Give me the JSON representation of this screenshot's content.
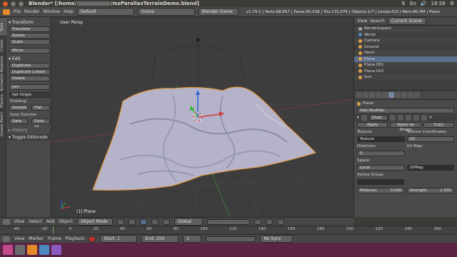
{
  "window": {
    "title": "Blender* [/home/",
    "title_path": "/mzParallaxTerrainDemo.blend]",
    "tray": {
      "net": "⇅",
      "lang": "En",
      "volume": "🔊",
      "time": "16:58",
      "settings": "⚙"
    }
  },
  "menubar": {
    "items": [
      "File",
      "Render",
      "Window",
      "Help"
    ],
    "layout": "Default",
    "scene": "Scene",
    "engine": "Blender Game",
    "stats": "v2.79.1 | Verts:88,657 | Faces:65,536 | Tris:131,076 | Objects:1/7 | Lamps:0/3 | Mem:80.4M | Plane"
  },
  "vtabs": [
    "Tools",
    "Create",
    "Relations",
    "Animation",
    "Physics",
    "Grease Pencil"
  ],
  "tools": {
    "transform_header": "▾ Transform",
    "translate": "Translate",
    "rotate": "Rotate",
    "scale": "Scale",
    "mirror": "Mirror",
    "edit_header": "▾ Edit",
    "duplicate": "Duplicate",
    "duplicate_linked": "Duplicate Linked",
    "delete": "Delete",
    "join": "Join",
    "set_origin": "Set Origin",
    "shading_label": "Shading:",
    "smooth": "Smooth",
    "flat": "Flat",
    "data_transfer_label": "Data Transfer:",
    "data": "Data",
    "data_layout": "Data La",
    "history_header": "▸ History",
    "toggle_editmode": "▾ Toggle Editmode"
  },
  "viewport": {
    "view_label": "User Persp",
    "object_label": "(1) Plane"
  },
  "view_header": {
    "view": "View",
    "select": "Select",
    "add": "Add",
    "object": "Object",
    "mode": "Object Mode",
    "orientation": "Global"
  },
  "timeline": {
    "numbers": [
      "-40",
      "-20",
      "0",
      "20",
      "40",
      "60",
      "80",
      "100",
      "120",
      "140",
      "160",
      "180",
      "200",
      "220",
      "240",
      "260"
    ],
    "view": "View",
    "marker": "Marker",
    "frame": "Frame",
    "playback": "Playback",
    "start": "Start:",
    "start_val": "1",
    "end": "End:",
    "end_val": "250",
    "current": "1",
    "sync": "No Sync"
  },
  "outliner": {
    "view": "View",
    "search": "Search",
    "scope": "Current Scene",
    "rows": [
      "RenderLayers",
      "World",
      "Camera",
      "Ground",
      "Hemi",
      "Plane",
      "Plane.001",
      "Plane.002",
      "Sun"
    ],
    "active_index": 5
  },
  "properties": {
    "object_name": "Plane",
    "add_modifier": "Add Modifier",
    "modifier_name": "Displ",
    "apply": "Apply",
    "apply_as_shape": "Apply as Shape",
    "copy": "Copy",
    "texture_label": "Texture:",
    "texture_value": "Texture",
    "texture_coords_label": "Texture Coordinates:",
    "texture_coords": "UV",
    "direction_label": "Direction:",
    "direction": "Z",
    "uvmap_label": "UV Map:",
    "space_label": "Space:",
    "space": "Local",
    "uvmap": "UVMap",
    "vertex_group_label": "Vertex Group:",
    "midlevel_label": "Midlevel:",
    "midlevel": "0.000",
    "strength_label": "Strength:",
    "strength": "1.000"
  },
  "colors": {
    "selection_orange": "#e89a3a",
    "axis_x": "#d23b3b",
    "axis_y": "#2db82d",
    "axis_z": "#2a63d8",
    "terrain": "#b4b3c9",
    "launcher": "#5a2447"
  }
}
